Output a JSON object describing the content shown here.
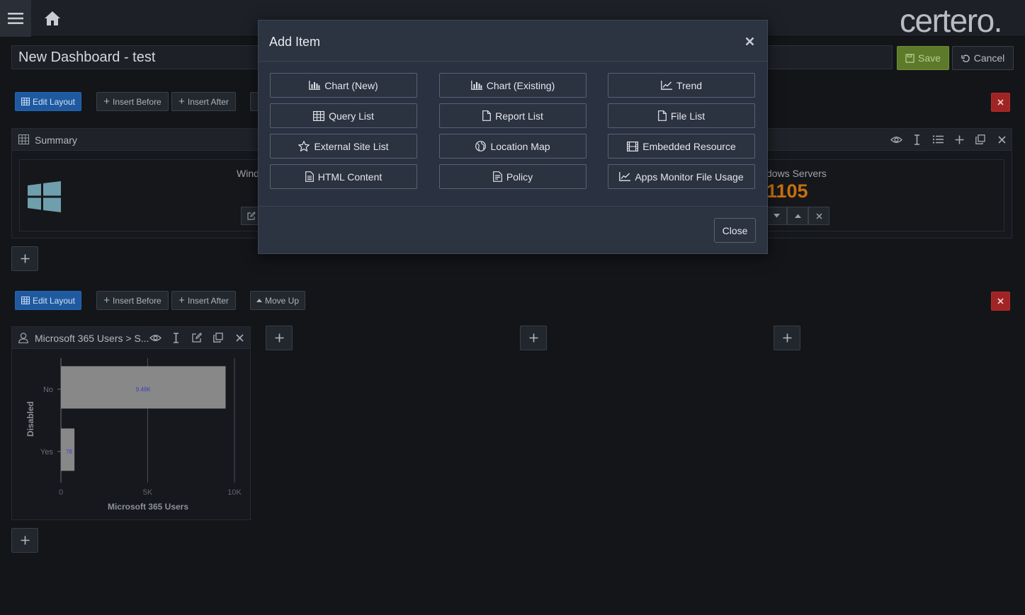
{
  "app": {
    "logo_text": "certero.",
    "dashboard_title": "New Dashboard - test",
    "save_label": "Save",
    "cancel_label": "Cancel"
  },
  "row1": {
    "edit_layout": "Edit Layout",
    "insert_before": "Insert Before",
    "insert_after": "Insert After",
    "summary_title": "Summary",
    "stat_left_label": "Wind",
    "stat_right_label": "dows Servers",
    "stat_right_value": "1105"
  },
  "row2": {
    "edit_layout": "Edit Layout",
    "insert_before": "Insert Before",
    "insert_after": "Insert After",
    "move_up": "Move Up",
    "panel_title": "Microsoft 365 Users > S...",
    "chart_data": {
      "type": "bar",
      "orientation": "horizontal",
      "categories": [
        "No",
        "Yes"
      ],
      "values": [
        9490,
        780
      ],
      "data_labels": [
        "9.49K",
        "78"
      ],
      "xlabel": "Microsoft 365 Users",
      "ylabel": "Disabled",
      "xlim": [
        0,
        10000
      ],
      "xticks": [
        "0",
        "5K",
        "10K"
      ],
      "bar_color": "#888888",
      "grid": true
    }
  },
  "modal": {
    "title": "Add Item",
    "close_label": "Close",
    "items": [
      {
        "label": "Chart (New)",
        "icon": "bar-chart-icon"
      },
      {
        "label": "Chart (Existing)",
        "icon": "bar-chart-icon"
      },
      {
        "label": "Trend",
        "icon": "trend-icon"
      },
      {
        "label": "Query List",
        "icon": "table-icon"
      },
      {
        "label": "Report List",
        "icon": "file-icon"
      },
      {
        "label": "File List",
        "icon": "file-icon"
      },
      {
        "label": "External Site List",
        "icon": "star-icon"
      },
      {
        "label": "Location Map",
        "icon": "globe-icon"
      },
      {
        "label": "Embedded Resource",
        "icon": "film-icon"
      },
      {
        "label": "HTML Content",
        "icon": "document-icon"
      },
      {
        "label": "Policy",
        "icon": "policy-icon"
      },
      {
        "label": "Apps Monitor File Usage",
        "icon": "trend-icon"
      }
    ]
  },
  "colors": {
    "accent_blue": "#1f5aa0",
    "save_green": "#5d7a2a",
    "danger_red": "#a12424",
    "stat_orange": "#c86f0e"
  }
}
